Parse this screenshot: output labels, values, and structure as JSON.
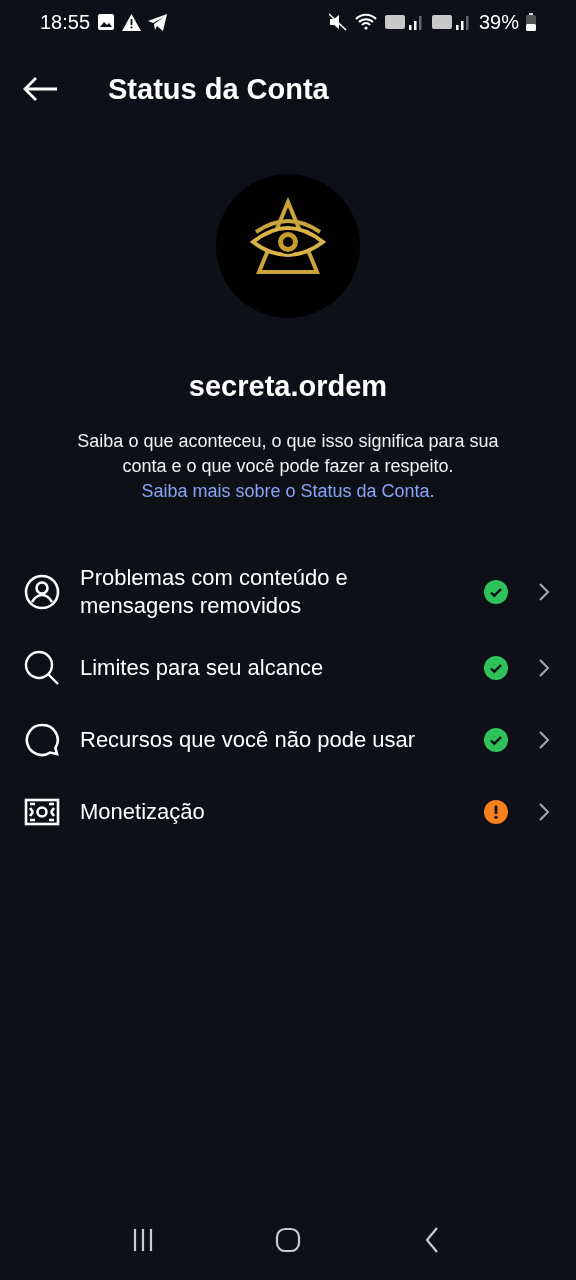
{
  "status_bar": {
    "time": "18:55",
    "battery": "39%"
  },
  "header": {
    "title": "Status da Conta"
  },
  "profile": {
    "username": "secreta.ordem",
    "description": "Saiba o que aconteceu, o que isso significa para sua conta e o que você pode fazer a respeito.",
    "link": "Saiba mais sobre o Status da Conta."
  },
  "items": [
    {
      "kind": "person",
      "label": "Problemas com conteúdo e mensagens removidos",
      "warning": false
    },
    {
      "kind": "search",
      "label": "Limites para seu alcance",
      "warning": false
    },
    {
      "kind": "bubble",
      "label": "Recursos que você não pode usar",
      "warning": false
    },
    {
      "kind": "money",
      "label": "Monetização",
      "warning": true
    }
  ]
}
